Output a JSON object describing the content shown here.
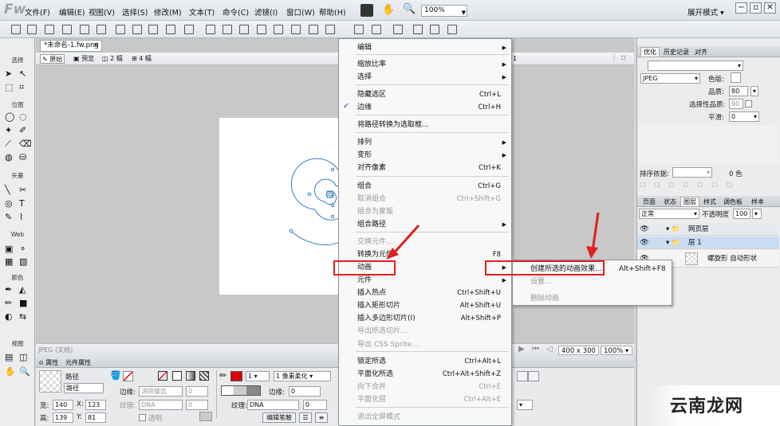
{
  "app": {
    "logo": "Fw",
    "workspace_mode": "展开模式"
  },
  "menubar": {
    "items": [
      "文件(F)",
      "编辑(E)",
      "视图(V)",
      "选择(S)",
      "修改(M)",
      "文本(T)",
      "命令(C)",
      "滤镜(I)",
      "窗口(W)",
      "帮助(H)"
    ],
    "zoom": "100%"
  },
  "document": {
    "tab_title": "*未命名-1.fw.png",
    "view_buttons": [
      "原始",
      "预览",
      "2 幅",
      "4 幅"
    ],
    "canvas_size": "400 x 300",
    "zoom": "100%",
    "status_left": "JPEG (文档)"
  },
  "left_tools": {
    "sections": [
      "选择",
      "位图",
      "矢量",
      "Web",
      "颜色",
      "视图"
    ]
  },
  "context_menu": {
    "items": [
      {
        "label": "编辑",
        "shortcut": "",
        "submenu": true,
        "disabled": false
      },
      {
        "label": "缩放比率",
        "shortcut": "",
        "submenu": true,
        "disabled": false
      },
      {
        "label": "选择",
        "shortcut": "",
        "submenu": true,
        "disabled": false
      },
      {
        "label": "隐藏选区",
        "shortcut": "Ctrl+L",
        "submenu": false,
        "disabled": false
      },
      {
        "label": "边缘",
        "shortcut": "Ctrl+H",
        "submenu": false,
        "disabled": false,
        "checked": true
      },
      {
        "label": "将路径转换为选取框...",
        "shortcut": "",
        "submenu": false,
        "disabled": false
      },
      {
        "label": "排列",
        "shortcut": "",
        "submenu": true,
        "disabled": false
      },
      {
        "label": "变形",
        "shortcut": "",
        "submenu": true,
        "disabled": false
      },
      {
        "label": "对齐像素",
        "shortcut": "Ctrl+K",
        "submenu": false,
        "disabled": false
      },
      {
        "label": "组合",
        "shortcut": "Ctrl+G",
        "submenu": false,
        "disabled": false
      },
      {
        "label": "取消组合",
        "shortcut": "Ctrl+Shift+G",
        "submenu": false,
        "disabled": true
      },
      {
        "label": "组合为蒙版",
        "shortcut": "",
        "submenu": false,
        "disabled": true
      },
      {
        "label": "组合路径",
        "shortcut": "",
        "submenu": true,
        "disabled": false
      },
      {
        "label": "交换元件...",
        "shortcut": "",
        "submenu": false,
        "disabled": true
      },
      {
        "label": "转换为元件",
        "shortcut": "F8",
        "submenu": false,
        "disabled": false
      },
      {
        "label": "动画",
        "shortcut": "",
        "submenu": true,
        "disabled": false,
        "highlighted": true
      },
      {
        "label": "元件",
        "shortcut": "",
        "submenu": true,
        "disabled": false
      },
      {
        "label": "插入热点",
        "shortcut": "Ctrl+Shift+U",
        "submenu": false,
        "disabled": false
      },
      {
        "label": "插入矩形切片",
        "shortcut": "Alt+Shift+U",
        "submenu": false,
        "disabled": false
      },
      {
        "label": "插入多边形切片(I)",
        "shortcut": "Alt+Shift+P",
        "submenu": false,
        "disabled": false
      },
      {
        "label": "导出所选切片...",
        "shortcut": "",
        "submenu": false,
        "disabled": true
      },
      {
        "label": "导出 CSS Sprite...",
        "shortcut": "",
        "submenu": false,
        "disabled": true
      },
      {
        "label": "锁定所选",
        "shortcut": "Ctrl+Alt+L",
        "submenu": false,
        "disabled": false
      },
      {
        "label": "平面化所选",
        "shortcut": "Ctrl+Alt+Shift+Z",
        "submenu": false,
        "disabled": false
      },
      {
        "label": "向下合并",
        "shortcut": "Ctrl+E",
        "submenu": false,
        "disabled": true
      },
      {
        "label": "平面化层",
        "shortcut": "Ctrl+Alt+E",
        "submenu": false,
        "disabled": true
      },
      {
        "label": "退出全屏模式",
        "shortcut": "",
        "submenu": false,
        "disabled": true
      }
    ]
  },
  "submenu": {
    "items": [
      {
        "label": "创建所选的动画效果...",
        "shortcut": "Alt+Shift+F8",
        "disabled": false
      },
      {
        "label": "设置...",
        "shortcut": "",
        "disabled": true
      },
      {
        "label": "删除动画",
        "shortcut": "",
        "disabled": true
      }
    ]
  },
  "right_panel": {
    "top_tabs": [
      "优化",
      "历史记录",
      "对齐"
    ],
    "format": "JPEG",
    "matte_label": "色版:",
    "quality_label": "品质:",
    "quality_value": "80",
    "selective_quality_label": "选择性品质:",
    "selective_quality_value": "90",
    "smoothing_label": "平滑:",
    "smoothing_value": "0",
    "sort_label": "排序依据:",
    "color_count": "0 色",
    "layer_tabs": [
      "页面",
      "状态",
      "图层",
      "样式",
      "调色板",
      "样本"
    ],
    "blend_mode": "正常",
    "opacity_label": "不透明度",
    "opacity_value": "100",
    "layers": [
      "网页层",
      "层 1",
      "螺旋形 自动形状"
    ]
  },
  "properties": {
    "tabs": [
      "属性",
      "元件属性"
    ],
    "object_type": "路径",
    "object_name": "路径",
    "width_label": "宽:",
    "width_value": "140",
    "height_label": "高:",
    "height_value": "139",
    "x_label": "X:",
    "x_value": "123",
    "y_label": "Y:",
    "y_value": "81",
    "edge_label": "边缘:",
    "edge_value": "消除锯齿",
    "edge_amount": "0",
    "texture_label": "纹理:",
    "texture_value": "DNA",
    "texture_amount": "0",
    "transparent_label": "透明",
    "stroke_size": "1",
    "stroke_type": "1 像素柔化",
    "stroke_edge_label": "边缘:",
    "stroke_edge_value": "0",
    "stroke_texture_label": "纹理:",
    "stroke_texture_value": "DNA",
    "stroke_texture_amount": "0",
    "edit_stroke_button": "编辑笔触"
  },
  "watermark": {
    "text": "云南龙网"
  },
  "colors": {
    "highlight_box": "#e02020",
    "stroke_color": "#e00000",
    "spiral": "#3b7dc4"
  }
}
